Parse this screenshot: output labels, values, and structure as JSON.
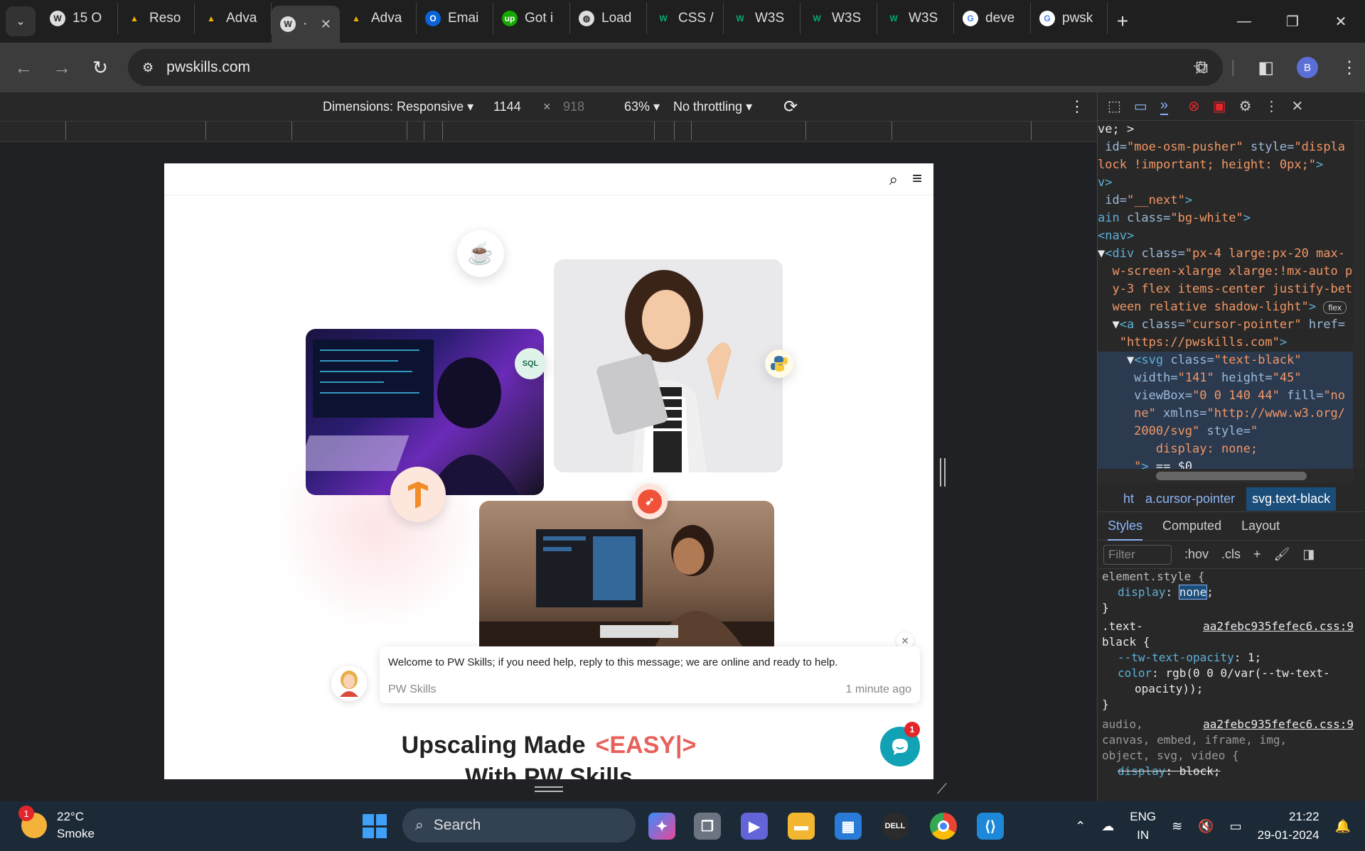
{
  "tabs": [
    {
      "label": "15 O",
      "icon": "wordpress-icon"
    },
    {
      "label": "Reso",
      "icon": "google-drive-icon"
    },
    {
      "label": "Adva",
      "icon": "google-drive-icon"
    },
    {
      "label": "·",
      "icon": "wordpress-icon",
      "active": true
    },
    {
      "label": "Adva",
      "icon": "google-drive-icon"
    },
    {
      "label": "Emai",
      "icon": "outlook-icon"
    },
    {
      "label": "Got i",
      "icon": "upwork-icon"
    },
    {
      "label": "Load",
      "icon": "globe-icon"
    },
    {
      "label": "CSS /",
      "icon": "w3schools-icon"
    },
    {
      "label": "W3S",
      "icon": "w3schools-icon"
    },
    {
      "label": "W3S",
      "icon": "w3schools-icon"
    },
    {
      "label": "W3S",
      "icon": "w3schools-icon"
    },
    {
      "label": "deve",
      "icon": "google-icon"
    },
    {
      "label": "pwsk",
      "icon": "google-icon"
    }
  ],
  "address": {
    "url": "pwskills.com"
  },
  "profile": {
    "initial": "B"
  },
  "device_toolbar": {
    "dimensions": "Dimensions: Responsive",
    "width": "1144",
    "times": "×",
    "height": "918",
    "zoom": "63%",
    "throttling": "No throttling"
  },
  "page": {
    "headline": "Upscaling Made",
    "headline_accent": "<EASY|>",
    "headline2": "With PW Skills",
    "chat": {
      "message": "Welcome to PW Skills; if you need help, reply to this message; we are online and ready to help.",
      "sender": "PW Skills",
      "time": "1 minute ago",
      "unread": "1"
    },
    "badges": {
      "sql": "SQL"
    }
  },
  "devtools": {
    "dom_lines": [
      {
        "parts": [
          [
            "p",
            "ve; >"
          ]
        ]
      },
      {
        "parts": [
          [
            "a",
            " id="
          ],
          [
            "v",
            "\"moe-osm-pusher\""
          ],
          [
            "a",
            " style="
          ],
          [
            "v",
            "\"displa"
          ]
        ]
      },
      {
        "parts": [
          [
            "v",
            "lock !important; height: 0px;\""
          ],
          [
            "t",
            ">"
          ]
        ]
      },
      {
        "parts": [
          [
            "t",
            "v>"
          ]
        ]
      },
      {
        "parts": [
          [
            "a",
            " id="
          ],
          [
            "v",
            "\"__next\""
          ],
          [
            "t",
            ">"
          ]
        ]
      },
      {
        "parts": [
          [
            "t",
            "ain "
          ],
          [
            "a",
            "class="
          ],
          [
            "v",
            "\"bg-white\""
          ],
          [
            "t",
            ">"
          ]
        ]
      },
      {
        "parts": [
          [
            "t",
            "<nav>"
          ]
        ]
      },
      {
        "parts": [
          [
            "p",
            "▼"
          ],
          [
            "t",
            "<div "
          ],
          [
            "a",
            "class="
          ],
          [
            "v",
            "\"px-4 large:px-20 max-"
          ]
        ]
      },
      {
        "parts": [
          [
            "v",
            "  w-screen-xlarge xlarge:!mx-auto p"
          ]
        ]
      },
      {
        "parts": [
          [
            "v",
            "  y-3 flex items-center justify-bet"
          ]
        ]
      },
      {
        "parts": [
          [
            "v",
            "  ween relative shadow-light\""
          ],
          [
            "t",
            ">"
          ]
        ],
        "badge": "flex"
      },
      {
        "parts": [
          [
            "p",
            "  ▼"
          ],
          [
            "t",
            "<a "
          ],
          [
            "a",
            "class="
          ],
          [
            "v",
            "\"cursor-pointer\""
          ],
          [
            "a",
            " href="
          ]
        ]
      },
      {
        "parts": [
          [
            "v",
            "   \"https://pwskills.com\""
          ],
          [
            "t",
            ">"
          ]
        ]
      },
      {
        "parts": [
          [
            "p",
            "    ▼"
          ],
          [
            "t",
            "<svg "
          ],
          [
            "a",
            "class="
          ],
          [
            "v",
            "\"text-black\""
          ]
        ],
        "sel": true
      },
      {
        "parts": [
          [
            "a",
            "     width="
          ],
          [
            "v",
            "\"141\""
          ],
          [
            "a",
            " height="
          ],
          [
            "v",
            "\"45\""
          ]
        ],
        "sel": true
      },
      {
        "parts": [
          [
            "a",
            "     viewBox="
          ],
          [
            "v",
            "\"0 0 140 44\""
          ],
          [
            "a",
            " fill="
          ],
          [
            "v",
            "\"no"
          ]
        ],
        "sel": true
      },
      {
        "parts": [
          [
            "v",
            "     ne\""
          ],
          [
            "a",
            " xmlns="
          ],
          [
            "v",
            "\"http://www.w3.org/"
          ]
        ],
        "sel": true
      },
      {
        "parts": [
          [
            "v",
            "     2000/svg\""
          ],
          [
            "a",
            " style="
          ],
          [
            "v",
            "\""
          ]
        ],
        "sel": true
      },
      {
        "parts": [
          [
            "v",
            "        display: none;"
          ]
        ],
        "sel": true
      },
      {
        "parts": [
          [
            "v",
            "     \""
          ],
          [
            "t",
            ">"
          ],
          [
            "p",
            " == $0"
          ]
        ],
        "sel": true
      }
    ],
    "crumbs": [
      "ht",
      "a.cursor-pointer",
      "svg.text-black"
    ],
    "subtabs": [
      "Styles",
      "Computed",
      "Layout"
    ],
    "filter_placeholder": "Filter",
    "hov": ":hov",
    "cls": ".cls",
    "rules": {
      "element_style": "element.style {",
      "display_prop": "display",
      "display_val": "none",
      "close": "}",
      "textblack_sel1": ".text-",
      "textblack_sel2": "black {",
      "source": "aa2febc935fefec6.css:9",
      "tw_prop": "--tw-text-opacity",
      "tw_val": "1;",
      "color_prop": "color",
      "color_val": "rgb(0 0 0/var(--tw-text-",
      "color_val2": "opacity));",
      "media_sel1": "audio,",
      "media_sel2": "canvas, embed, iframe, img,",
      "media_sel3": "object, svg, video {",
      "block_prop": "display",
      "block_val": "block;"
    }
  },
  "taskbar": {
    "temp": "22°C",
    "condition": "Smoke",
    "weather_badge": "1",
    "search": "Search",
    "lang1": "ENG",
    "lang2": "IN",
    "time": "21:22",
    "date": "29-01-2024"
  },
  "colors": {
    "accent_easy": "#e8605b",
    "chat_teal": "#11a3b5",
    "devtools_selection": "#1a4d7a"
  }
}
